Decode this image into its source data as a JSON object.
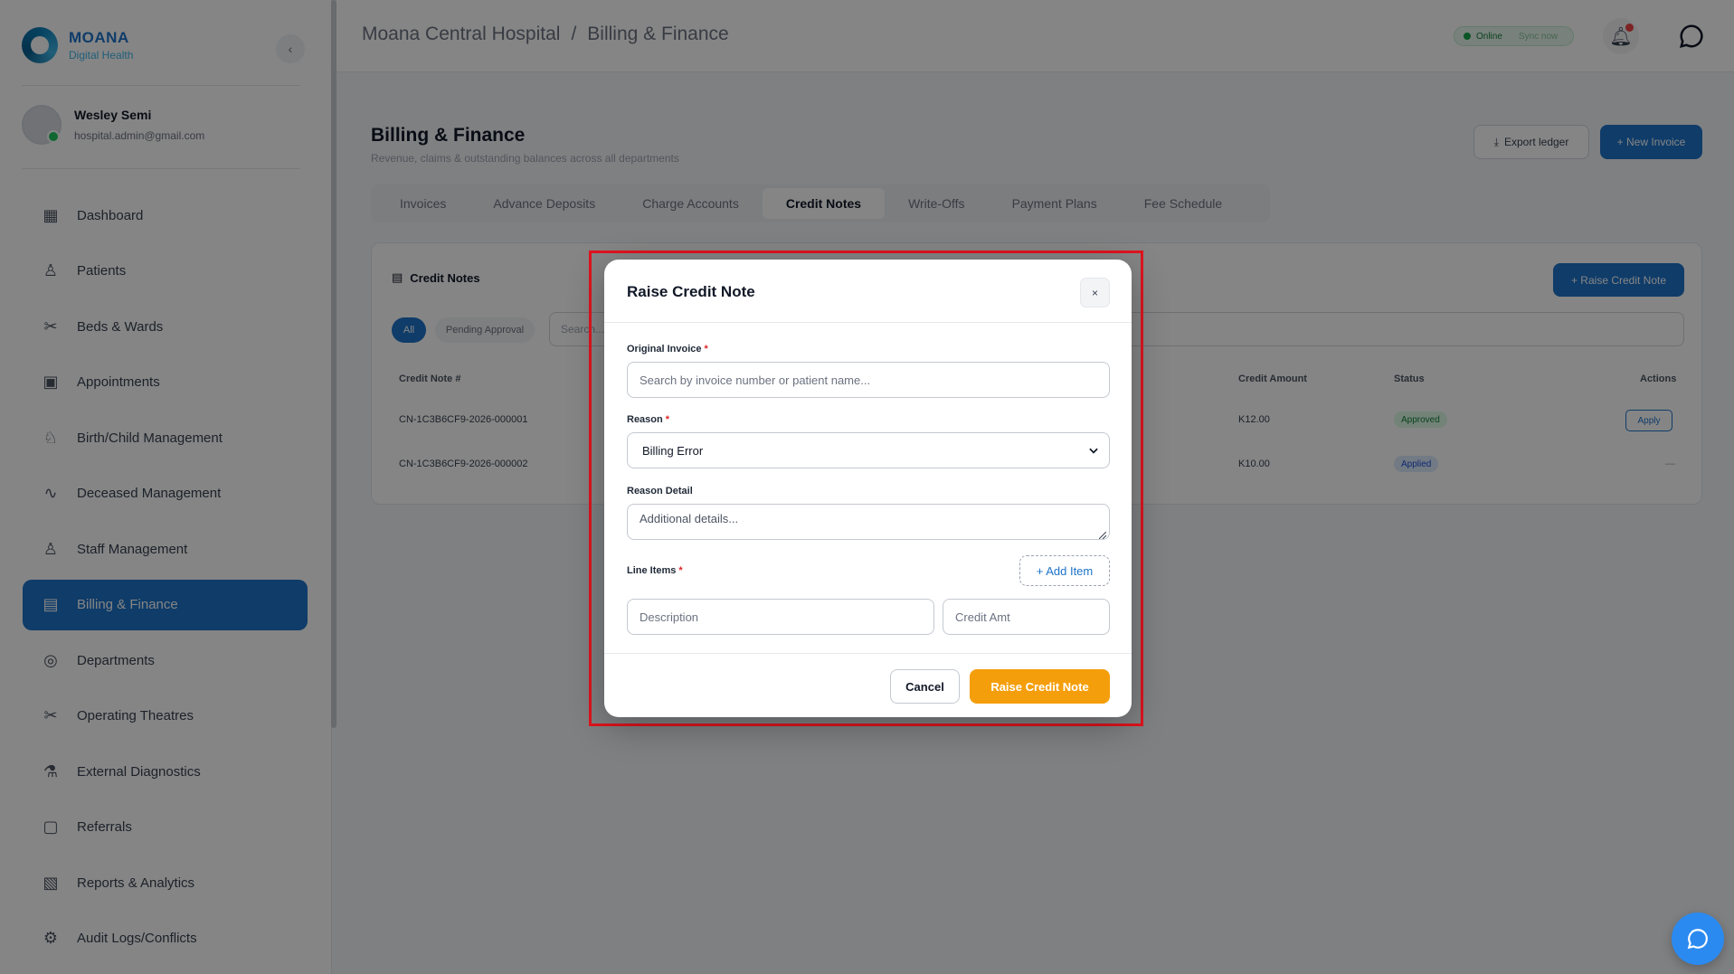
{
  "brand": {
    "name": "MOANA",
    "subtitle": "Digital Health"
  },
  "user": {
    "name": "Wesley Semi",
    "email": "hospital.admin@gmail.com"
  },
  "sidebar": {
    "items": [
      {
        "label": "Dashboard",
        "icon": "grid-icon"
      },
      {
        "label": "Patients",
        "icon": "patients-icon"
      },
      {
        "label": "Beds & Wards",
        "icon": "bed-icon"
      },
      {
        "label": "Appointments",
        "icon": "calendar-icon"
      },
      {
        "label": "Birth/Child Management",
        "icon": "baby-icon"
      },
      {
        "label": "Deceased Management",
        "icon": "pulse-icon"
      },
      {
        "label": "Staff Management",
        "icon": "staff-icon"
      },
      {
        "label": "Billing & Finance",
        "icon": "billing-icon",
        "active": true
      },
      {
        "label": "Departments",
        "icon": "department-icon"
      },
      {
        "label": "Operating Theatres",
        "icon": "theatre-icon"
      },
      {
        "label": "External Diagnostics",
        "icon": "diagnostics-icon"
      },
      {
        "label": "Referrals",
        "icon": "referral-icon"
      },
      {
        "label": "Reports & Analytics",
        "icon": "reports-icon"
      },
      {
        "label": "Audit Logs/Conflicts",
        "icon": "audit-icon"
      }
    ]
  },
  "topbar": {
    "breadcrumb_root": "Moana Central Hospital",
    "breadcrumb_sep": "/",
    "breadcrumb_current": "Billing & Finance",
    "status": "Online",
    "sync": "Sync now"
  },
  "page": {
    "title": "Billing & Finance",
    "subtitle": "Revenue, claims & outstanding balances across all departments",
    "export_label": "Export ledger",
    "new_invoice_label": "+ New Invoice",
    "tabs": [
      "Invoices",
      "Advance Deposits",
      "Charge Accounts",
      "Credit Notes",
      "Write-Offs",
      "Payment Plans",
      "Fee Schedule"
    ],
    "active_tab": "Credit Notes"
  },
  "credit_notes_card": {
    "title": "Credit Notes",
    "raise_label": "+ Raise Credit Note",
    "filters": [
      "All",
      "Pending Approval"
    ],
    "search_placeholder": "Search...",
    "columns": {
      "number": "Credit Note #",
      "amount": "Credit Amount",
      "status": "Status",
      "actions": "Actions"
    },
    "rows": [
      {
        "number": "CN-1C3B6CF9-2026-000001",
        "amount": "K12.00",
        "status": "Approved",
        "action": "Apply"
      },
      {
        "number": "CN-1C3B6CF9-2026-000002",
        "amount": "K10.00",
        "status": "Applied",
        "action": "—"
      }
    ]
  },
  "modal": {
    "title": "Raise Credit Note",
    "close": "×",
    "original_invoice_label": "Original Invoice",
    "original_invoice_placeholder": "Search by invoice number or patient name...",
    "reason_label": "Reason",
    "reason_value": "Billing Error",
    "reason_detail_label": "Reason Detail",
    "reason_detail_placeholder": "Additional details...",
    "line_items_label": "Line Items",
    "add_item_label": "+ Add Item",
    "description_placeholder": "Description",
    "credit_amt_placeholder": "Credit Amt",
    "required_mark": "*",
    "cancel_label": "Cancel",
    "submit_label": "Raise Credit Note"
  },
  "colors": {
    "primary": "#1d73c9",
    "accent": "#f59e0b",
    "highlight": "#e0141e"
  }
}
